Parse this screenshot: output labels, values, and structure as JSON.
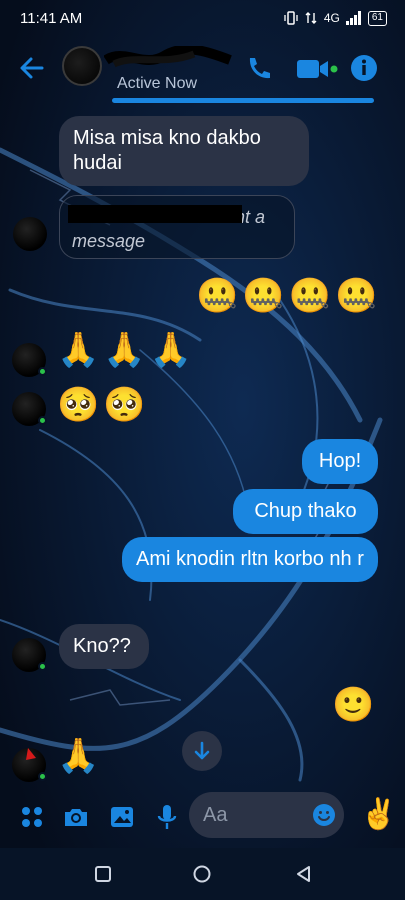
{
  "status_bar": {
    "time": "11:41 AM",
    "network": "4G",
    "battery": "61"
  },
  "header": {
    "status": "Active Now",
    "accent_color": "#1a86e0",
    "icons": [
      "back-arrow-icon",
      "phone-icon",
      "video-camera-icon",
      "info-icon"
    ]
  },
  "messages": {
    "m1": "Misa misa kno dakbo hudai",
    "m2_unsent": "unsent a message",
    "m2_visible": "ensent a",
    "m2_line2": "message",
    "emojis_out_1": "🤐🤐🤐🤐",
    "emojis_in_1": "🙏🙏🙏",
    "emojis_in_2": "🥺🥺",
    "out_1": "Hop!",
    "out_2": "Chup thako",
    "out_3": "Ami knodin rltn korbo nh r",
    "in_3": "Kno??",
    "emoji_out_2": "🙂",
    "emoji_in_3": "🙏"
  },
  "composer": {
    "placeholder": "Aa",
    "quick_reaction": "✌️",
    "icons": [
      "apps-icon",
      "camera-icon",
      "gallery-icon",
      "microphone-icon",
      "emoji-icon"
    ]
  },
  "colors": {
    "background": "#071427",
    "incoming_bubble": "#2b3346",
    "outgoing_bubble": "#1a86e0",
    "online_dot": "#2bc24a"
  }
}
